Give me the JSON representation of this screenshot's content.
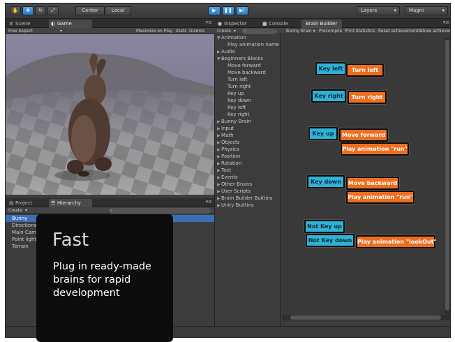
{
  "toolbar": {
    "center_label": "Center",
    "local_label": "Local",
    "layers_label": "Layers",
    "layout_label": "Magni"
  },
  "scene_tabs": {
    "scene": "Scene",
    "game": "Game"
  },
  "game_bar": {
    "aspect": "Free Aspect",
    "maximize": "Maximize on Play",
    "stats": "Stats",
    "gizmos": "Gizmos"
  },
  "bottom_tabs": {
    "project": "Project",
    "hierarchy": "Hierarchy"
  },
  "hierarchy_create": "Create",
  "hierarchy_items": [
    "Bunny",
    "Directional li",
    "Main Camera",
    "Point light",
    "Terrain"
  ],
  "overlay": {
    "title": "Fast",
    "text": "Plug in ready-made brains for rapid development"
  },
  "inspector_tabs": {
    "inspector": "Inspector",
    "console": "Console",
    "brain_builder": "Brain Builder"
  },
  "tree_create": "Create",
  "tree": [
    {
      "type": "cat",
      "label": "Animation",
      "open": true
    },
    {
      "type": "item",
      "label": "Play animation name"
    },
    {
      "type": "cat",
      "label": "Audio",
      "open": false
    },
    {
      "type": "cat",
      "label": "Beginners Blocks",
      "open": true
    },
    {
      "type": "item",
      "label": "Move forward"
    },
    {
      "type": "item",
      "label": "Move backward"
    },
    {
      "type": "item",
      "label": "Turn left"
    },
    {
      "type": "item",
      "label": "Turn right"
    },
    {
      "type": "item",
      "label": "Key up"
    },
    {
      "type": "item",
      "label": "Key down"
    },
    {
      "type": "item",
      "label": "Key left"
    },
    {
      "type": "item",
      "label": "Key right"
    },
    {
      "type": "cat",
      "label": "Bunny Brain",
      "open": false
    },
    {
      "type": "cat",
      "label": "Input",
      "open": false
    },
    {
      "type": "cat",
      "label": "Math",
      "open": false
    },
    {
      "type": "cat",
      "label": "Objects",
      "open": false
    },
    {
      "type": "cat",
      "label": "Physics",
      "open": false
    },
    {
      "type": "cat",
      "label": "Position",
      "open": false
    },
    {
      "type": "cat",
      "label": "Rotation",
      "open": false
    },
    {
      "type": "cat",
      "label": "Text",
      "open": false
    },
    {
      "type": "cat",
      "label": "Events",
      "open": false
    },
    {
      "type": "cat",
      "label": "Other Brains",
      "open": false
    },
    {
      "type": "cat",
      "label": "User Scripts",
      "open": false
    },
    {
      "type": "cat",
      "label": "Brain Builder Builtins",
      "open": false
    },
    {
      "type": "cat",
      "label": "Unity Builtins",
      "open": false
    }
  ],
  "brain_toolbar": {
    "brain_name": "Bunny Brain",
    "precompile": "Precompile",
    "print_stats": "Print Statistics",
    "reset": "Reset achievements",
    "show": "Show achievements"
  },
  "nodes": {
    "key_left": "Key left",
    "turn_left": "Turn left",
    "key_right": "Key right",
    "turn_right": "Turn right",
    "key_up": "Key up",
    "move_forward": "Move forward",
    "play_run_1": "Play animation \"run\"",
    "key_down": "Key down",
    "move_backward": "Move backward",
    "play_run_2": "Play animation \"run\"",
    "not_key_up": "Not Key up",
    "not_key_down": "Not Key down",
    "play_lookout": "Play animation \"lookOut\""
  },
  "colors": {
    "key_node": "#2fb2d6",
    "action_node": "#ef6d1f",
    "selection": "#3b6fb5"
  }
}
